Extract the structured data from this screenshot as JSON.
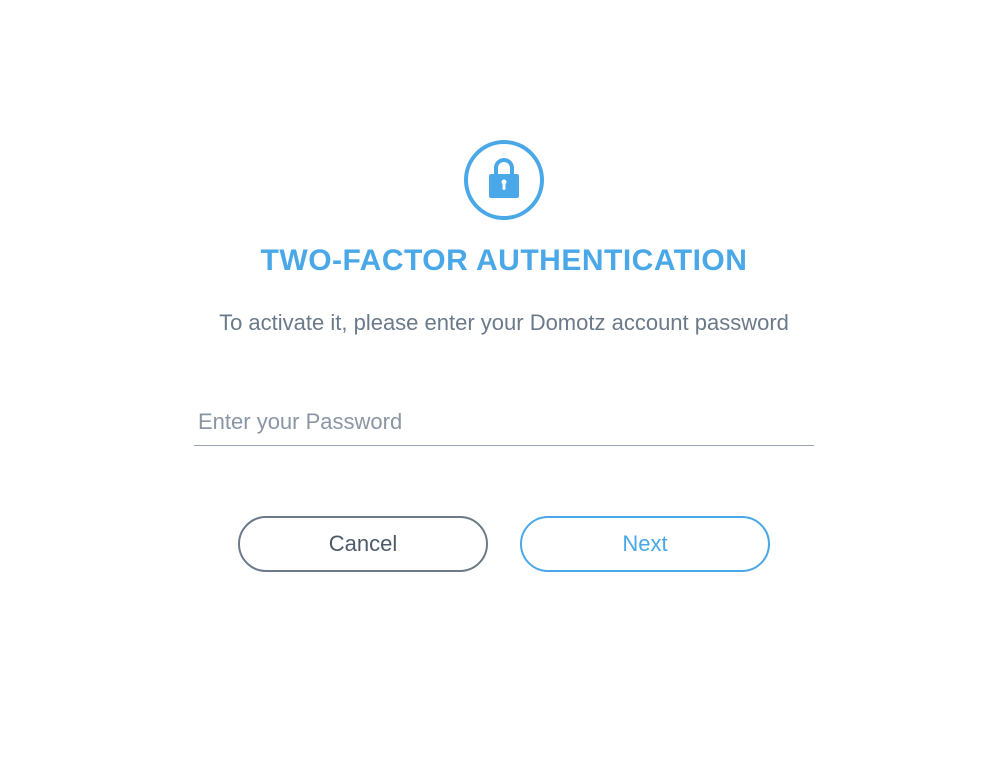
{
  "colors": {
    "accent": "#4AA8E8",
    "muted": "#6B7A8A"
  },
  "dialog": {
    "title": "TWO-FACTOR AUTHENTICATION",
    "subtitle": "To activate it, please enter your Domotz account password",
    "password_placeholder": "Enter your Password",
    "password_value": "",
    "cancel_label": "Cancel",
    "next_label": "Next"
  }
}
